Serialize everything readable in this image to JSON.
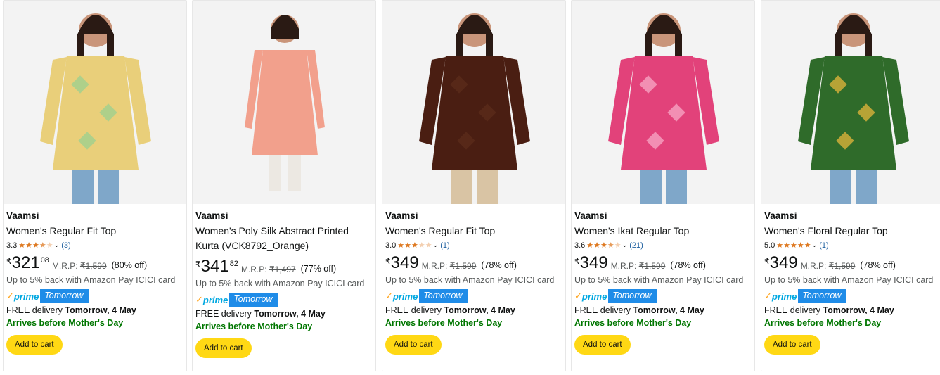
{
  "products": [
    {
      "brand": "Vaamsi",
      "title": "Women's Regular Fit Top",
      "has_rating": true,
      "rating": "3.3",
      "stars": [
        "full",
        "full",
        "full",
        "half",
        "empty"
      ],
      "review_count": "(3)",
      "currency": "₹",
      "price_whole": "321",
      "price_fraction": "08",
      "mrp_label": "M.R.P:",
      "mrp": "₹1,599",
      "discount": "(80% off)",
      "cashback": "Up to 5% back with Amazon Pay ICICI card",
      "prime_label": "prime",
      "prime_badge": "Tomorrow",
      "delivery_prefix": "FREE delivery",
      "delivery_date": "Tomorrow, 4 May",
      "arrives": "Arrives before Mother's Day",
      "add_to_cart": "Add to cart",
      "image_desc": "model-yellow-green-check-top",
      "garment_color": "#e9cf7a",
      "garment_accent": "#9fcf8e"
    },
    {
      "brand": "Vaamsi",
      "title": "Women's Poly Silk Abstract Printed Kurta (VCK8792_Orange)",
      "has_rating": false,
      "rating": "",
      "stars": [],
      "review_count": "",
      "currency": "₹",
      "price_whole": "341",
      "price_fraction": "82",
      "mrp_label": "M.R.P:",
      "mrp": "₹1,497",
      "discount": "(77% off)",
      "cashback": "Up to 5% back with Amazon Pay ICICI card",
      "prime_label": "prime",
      "prime_badge": "Tomorrow",
      "delivery_prefix": "FREE delivery",
      "delivery_date": "Tomorrow, 4 May",
      "arrives": "Arrives before Mother's Day",
      "add_to_cart": "Add to cart",
      "image_desc": "model-peach-kurta",
      "garment_color": "#f2a08c",
      "garment_accent": "#f7d1c4"
    },
    {
      "brand": "Vaamsi",
      "title": "Women's Regular Fit Top",
      "has_rating": true,
      "rating": "3.0",
      "stars": [
        "full",
        "full",
        "full",
        "empty",
        "empty"
      ],
      "review_count": "(1)",
      "currency": "₹",
      "price_whole": "349",
      "price_fraction": "",
      "mrp_label": "M.R.P:",
      "mrp": "₹1,599",
      "discount": "(78% off)",
      "cashback": "Up to 5% back with Amazon Pay ICICI card",
      "prime_label": "prime",
      "prime_badge": "Tomorrow",
      "delivery_prefix": "FREE delivery",
      "delivery_date": "Tomorrow, 4 May",
      "arrives": "Arrives before Mother's Day",
      "add_to_cart": "Add to cart",
      "image_desc": "model-brown-top",
      "garment_color": "#4a1e12",
      "garment_accent": "#5a2a1a"
    },
    {
      "brand": "Vaamsi",
      "title": "Women's Ikat Regular Top",
      "has_rating": true,
      "rating": "3.6",
      "stars": [
        "full",
        "full",
        "full",
        "half",
        "empty"
      ],
      "review_count": "(21)",
      "currency": "₹",
      "price_whole": "349",
      "price_fraction": "",
      "mrp_label": "M.R.P:",
      "mrp": "₹1,599",
      "discount": "(78% off)",
      "cashback": "Up to 5% back with Amazon Pay ICICI card",
      "prime_label": "prime",
      "prime_badge": "Tomorrow",
      "delivery_prefix": "FREE delivery",
      "delivery_date": "Tomorrow, 4 May",
      "arrives": "Arrives before Mother's Day",
      "add_to_cart": "Add to cart",
      "image_desc": "model-pink-ikat-top",
      "garment_color": "#e2427a",
      "garment_accent": "#f6a3c2"
    },
    {
      "brand": "Vaamsi",
      "title": "Women's Floral Regular Top",
      "has_rating": true,
      "rating": "5.0",
      "stars": [
        "full",
        "full",
        "full",
        "full",
        "full"
      ],
      "review_count": "(1)",
      "currency": "₹",
      "price_whole": "349",
      "price_fraction": "",
      "mrp_label": "M.R.P:",
      "mrp": "₹1,599",
      "discount": "(78% off)",
      "cashback": "Up to 5% back with Amazon Pay ICICI card",
      "prime_label": "prime",
      "prime_badge": "Tomorrow",
      "delivery_prefix": "FREE delivery",
      "delivery_date": "Tomorrow, 4 May",
      "arrives": "Arrives before Mother's Day",
      "add_to_cart": "Add to cart",
      "image_desc": "model-green-floral-top",
      "garment_color": "#2f6b2a",
      "garment_accent": "#d9b13a"
    }
  ],
  "colors": {
    "prime_blue": "#00a8e1",
    "tomorrow_badge": "#1f8ce8",
    "arrives_green": "#007600",
    "button_yellow": "#ffd814",
    "star_orange": "#de7921",
    "link_blue": "#2162a1"
  }
}
